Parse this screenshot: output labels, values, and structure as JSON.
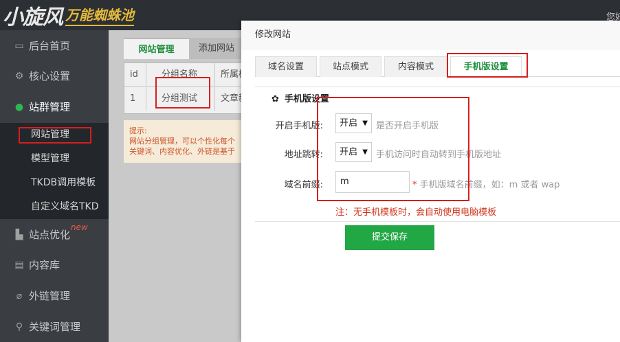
{
  "header": {
    "logo_main": "小旋风",
    "logo_sub": "万能蜘蛛池",
    "greeting": "您好"
  },
  "sidebar": {
    "items": [
      {
        "label": "后台首页",
        "icon": "monitor-icon"
      },
      {
        "label": "核心设置",
        "icon": "gear-icon"
      },
      {
        "label": "站群管理",
        "icon": "person-icon"
      },
      {
        "label": "站点优化",
        "icon": "chart-icon",
        "badge": "new"
      },
      {
        "label": "内容库",
        "icon": "document-icon"
      },
      {
        "label": "外链管理",
        "icon": "link-icon"
      },
      {
        "label": "关键词管理",
        "icon": "key-icon"
      }
    ],
    "subitems": [
      {
        "label": "网站管理"
      },
      {
        "label": "模型管理"
      },
      {
        "label": "TKDB调用模板"
      },
      {
        "label": "自定义域名TKD"
      }
    ]
  },
  "main": {
    "tabs": [
      {
        "label": "网站管理"
      },
      {
        "label": "添加网站"
      }
    ],
    "table": {
      "headers": [
        "id",
        "分组名称",
        "所属模"
      ],
      "rows": [
        [
          "1",
          "分组测试",
          "文章新"
        ]
      ]
    },
    "tip": {
      "title": "提示:",
      "line1": "网站分组管理，可以个性化每个",
      "line2": "关键词、内容优化、外链是基于"
    }
  },
  "modal": {
    "title": "修改网站",
    "tabs": [
      {
        "label": "域名设置"
      },
      {
        "label": "站点模式"
      },
      {
        "label": "内容模式"
      },
      {
        "label": "手机版设置"
      }
    ],
    "section_title": "手机版设置",
    "fields": {
      "mobile_enable": {
        "label": "开启手机版:",
        "value": "开启",
        "hint": "是否开启手机版"
      },
      "redirect": {
        "label": "地址跳转:",
        "value": "开启",
        "hint": "手机访问时自动转到手机版地址"
      },
      "prefix": {
        "label": "域名前缀:",
        "value": "m",
        "hint": "手机版域名前缀，如：m 或者 wap"
      }
    },
    "note": "注：无手机模板时，会自动使用电脑模板",
    "submit_label": "提交保存"
  },
  "colors": {
    "accent_green": "#22a745",
    "highlight_red": "#d81e1e",
    "sidebar_bg": "#3a3d42"
  }
}
